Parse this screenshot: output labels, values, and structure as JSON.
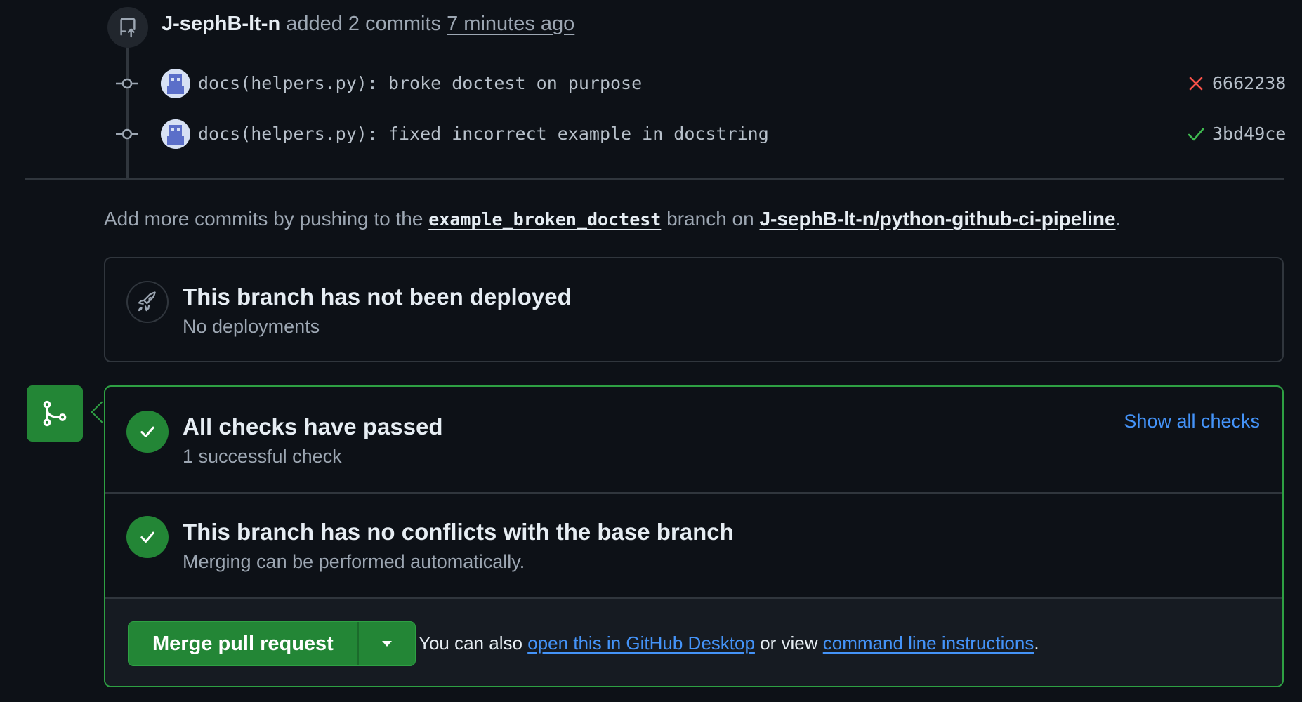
{
  "push_event": {
    "author": "J-sephB-lt-n",
    "action": "added 2 commits",
    "time": "7 minutes ago"
  },
  "commits": [
    {
      "message": "docs(helpers.py): broke doctest on purpose",
      "status": "failed",
      "sha": "6662238",
      "status_color": "#f85149"
    },
    {
      "message": "docs(helpers.py): fixed incorrect example in docstring",
      "status": "passed",
      "sha": "3bd49ce",
      "status_color": "#3fb950"
    }
  ],
  "hint": {
    "prefix": "Add more commits by pushing to the",
    "branch": "example_broken_doctest",
    "middle": "branch on",
    "repo": "J-sephB-lt-n/python-github-ci-pipeline",
    "suffix": "."
  },
  "deployment": {
    "title": "This branch has not been deployed",
    "subtitle": "No deployments",
    "icon": "rocket-icon"
  },
  "checks": {
    "title": "All checks have passed",
    "subtitle": "1 successful check",
    "show_all_label": "Show all checks"
  },
  "conflicts": {
    "title": "This branch has no conflicts with the base branch",
    "subtitle": "Merging can be performed automatically."
  },
  "merge": {
    "button_label": "Merge pull request",
    "also_prefix": "You can also",
    "desktop_link": "open this in GitHub Desktop",
    "or_view": "or view",
    "cli_link": "command line instructions",
    "suffix": "."
  },
  "colors": {
    "background": "#0d1117",
    "success": "#238636",
    "link": "#4493f8",
    "danger": "#f85149"
  }
}
